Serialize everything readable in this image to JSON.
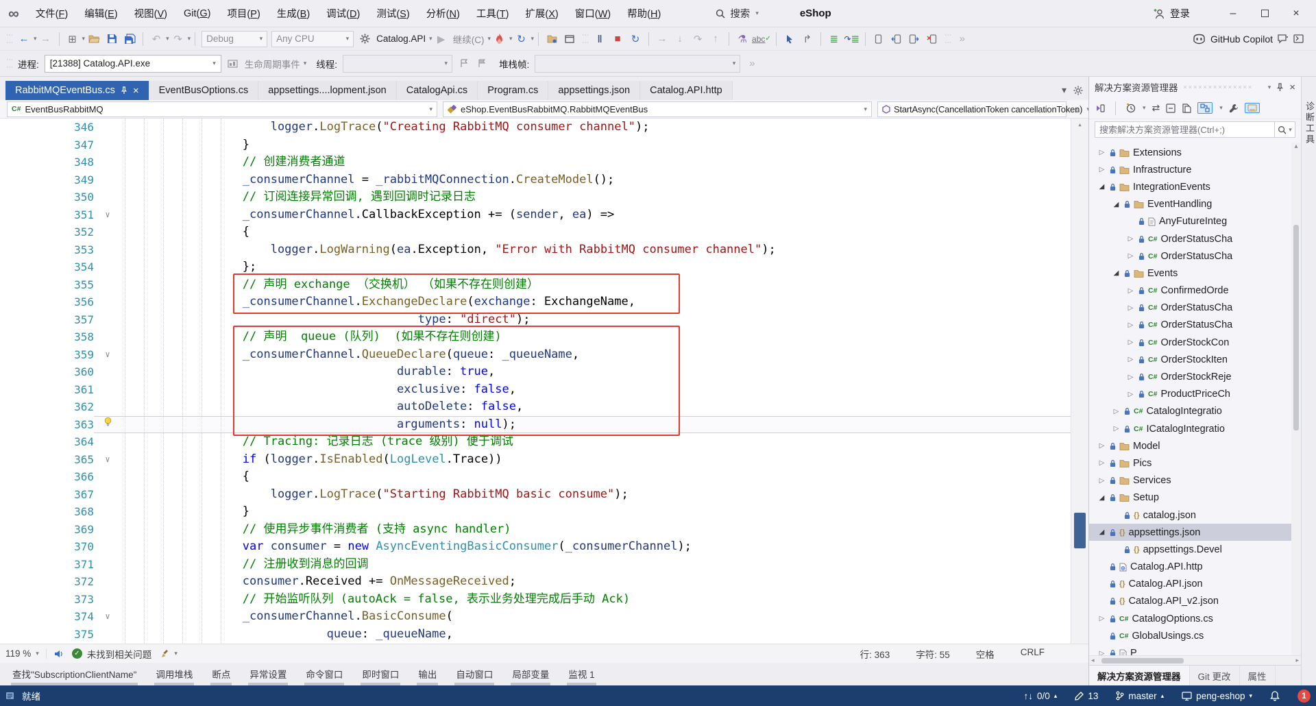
{
  "menubar": {
    "items": [
      "文件(F)",
      "编辑(E)",
      "视图(V)",
      "Git(G)",
      "项目(P)",
      "生成(B)",
      "调试(D)",
      "测试(S)",
      "分析(N)",
      "工具(T)",
      "扩展(X)",
      "窗口(W)",
      "帮助(H)"
    ],
    "search_label": "搜索",
    "project_badge": "eShop",
    "signin_label": "登录"
  },
  "toolbar": {
    "debug_config": "Debug",
    "platform": "Any CPU",
    "startup_project": "Catalog.API",
    "continue_label": "继续(C)",
    "copilot_label": "GitHub Copilot"
  },
  "debug_bar": {
    "process_label": "进程:",
    "process_value": "[21388] Catalog.API.exe",
    "lifecycle_label": "生命周期事件",
    "thread_label": "线程:",
    "stackframe_label": "堆栈帧:"
  },
  "tabs": [
    {
      "label": "RabbitMQEventBus.cs",
      "active": true
    },
    {
      "label": "EventBusOptions.cs"
    },
    {
      "label": "appsettings....lopment.json"
    },
    {
      "label": "CatalogApi.cs"
    },
    {
      "label": "Program.cs"
    },
    {
      "label": "appsettings.json"
    },
    {
      "label": "Catalog.API.http"
    }
  ],
  "breadcrumb": {
    "scope": "EventBusRabbitMQ",
    "type": "eShop.EventBusRabbitMQ.RabbitMQEventBus",
    "member": "StartAsync(CancellationToken cancellationToken)"
  },
  "editor": {
    "first_line": 346,
    "current_line": 363,
    "folds": {
      "351": "chevron",
      "359": "chevron",
      "363": "bulb",
      "365": "chevron",
      "374": "chevron"
    },
    "red_boxes": [
      {
        "from": 355,
        "to": 356
      },
      {
        "from": 358,
        "to": 363
      }
    ],
    "lines": [
      [
        [
          "p",
          "                    "
        ],
        [
          "v",
          "logger"
        ],
        [
          "p",
          "."
        ],
        [
          "m",
          "LogTrace"
        ],
        [
          "p",
          "("
        ],
        [
          "s",
          "\"Creating RabbitMQ consumer channel\""
        ],
        [
          "p",
          ");"
        ]
      ],
      [
        [
          "p",
          "                }"
        ]
      ],
      [
        [
          "p",
          "                "
        ],
        [
          "c",
          "// 创建消费者通道"
        ]
      ],
      [
        [
          "p",
          "                "
        ],
        [
          "v",
          "_consumerChannel"
        ],
        [
          "p",
          " = "
        ],
        [
          "v",
          "_rabbitMQConnection"
        ],
        [
          "p",
          "."
        ],
        [
          "m",
          "CreateModel"
        ],
        [
          "p",
          "();"
        ]
      ],
      [
        [
          "p",
          "                "
        ],
        [
          "c",
          "// 订阅连接异常回调, 遇到回调时记录日志"
        ]
      ],
      [
        [
          "p",
          "                "
        ],
        [
          "v",
          "_consumerChannel"
        ],
        [
          "p",
          ".CallbackException += ("
        ],
        [
          "v",
          "sender"
        ],
        [
          "p",
          ", "
        ],
        [
          "v",
          "ea"
        ],
        [
          "p",
          ") =>"
        ]
      ],
      [
        [
          "p",
          "                {"
        ]
      ],
      [
        [
          "p",
          "                    "
        ],
        [
          "v",
          "logger"
        ],
        [
          "p",
          "."
        ],
        [
          "m",
          "LogWarning"
        ],
        [
          "p",
          "("
        ],
        [
          "v",
          "ea"
        ],
        [
          "p",
          ".Exception, "
        ],
        [
          "s",
          "\"Error with RabbitMQ consumer channel\""
        ],
        [
          "p",
          ");"
        ]
      ],
      [
        [
          "p",
          "                };"
        ]
      ],
      [
        [
          "p",
          "                "
        ],
        [
          "c",
          "// 声明 exchange （交换机） （如果不存在则创建）"
        ]
      ],
      [
        [
          "p",
          "                "
        ],
        [
          "v",
          "_consumerChannel"
        ],
        [
          "p",
          "."
        ],
        [
          "m",
          "ExchangeDeclare"
        ],
        [
          "p",
          "("
        ],
        [
          "v",
          "exchange"
        ],
        [
          "p",
          ": ExchangeName,"
        ]
      ],
      [
        [
          "p",
          "                                         "
        ],
        [
          "v",
          "type"
        ],
        [
          "p",
          ": "
        ],
        [
          "s",
          "\"direct\""
        ],
        [
          "p",
          ");"
        ]
      ],
      [
        [
          "p",
          "                "
        ],
        [
          "c",
          "// 声明  queue (队列)  (如果不存在则创建)"
        ]
      ],
      [
        [
          "p",
          "                "
        ],
        [
          "v",
          "_consumerChannel"
        ],
        [
          "p",
          "."
        ],
        [
          "m",
          "QueueDeclare"
        ],
        [
          "p",
          "("
        ],
        [
          "v",
          "queue"
        ],
        [
          "p",
          ": "
        ],
        [
          "v",
          "_queueName"
        ],
        [
          "p",
          ","
        ]
      ],
      [
        [
          "p",
          "                                      "
        ],
        [
          "v",
          "durable"
        ],
        [
          "p",
          ": "
        ],
        [
          "k",
          "true"
        ],
        [
          "p",
          ","
        ]
      ],
      [
        [
          "p",
          "                                      "
        ],
        [
          "v",
          "exclusive"
        ],
        [
          "p",
          ": "
        ],
        [
          "k",
          "false"
        ],
        [
          "p",
          ","
        ]
      ],
      [
        [
          "p",
          "                                      "
        ],
        [
          "v",
          "autoDelete"
        ],
        [
          "p",
          ": "
        ],
        [
          "k",
          "false"
        ],
        [
          "p",
          ","
        ]
      ],
      [
        [
          "p",
          "                                      "
        ],
        [
          "v",
          "arguments"
        ],
        [
          "p",
          ": "
        ],
        [
          "k",
          "null"
        ],
        [
          "p",
          ");"
        ]
      ],
      [
        [
          "p",
          "                "
        ],
        [
          "c",
          "// Tracing: 记录日志 (trace 级别) 便于调试"
        ]
      ],
      [
        [
          "p",
          "                "
        ],
        [
          "k",
          "if"
        ],
        [
          "p",
          " ("
        ],
        [
          "v",
          "logger"
        ],
        [
          "p",
          "."
        ],
        [
          "m",
          "IsEnabled"
        ],
        [
          "p",
          "("
        ],
        [
          "t",
          "LogLevel"
        ],
        [
          "p",
          ".Trace))"
        ]
      ],
      [
        [
          "p",
          "                {"
        ]
      ],
      [
        [
          "p",
          "                    "
        ],
        [
          "v",
          "logger"
        ],
        [
          "p",
          "."
        ],
        [
          "m",
          "LogTrace"
        ],
        [
          "p",
          "("
        ],
        [
          "s",
          "\"Starting RabbitMQ basic consume\""
        ],
        [
          "p",
          ");"
        ]
      ],
      [
        [
          "p",
          "                }"
        ]
      ],
      [
        [
          "p",
          "                "
        ],
        [
          "c",
          "// 使用异步事件消费者 (支持 async handler)"
        ]
      ],
      [
        [
          "p",
          "                "
        ],
        [
          "k",
          "var"
        ],
        [
          "p",
          " "
        ],
        [
          "v",
          "consumer"
        ],
        [
          "p",
          " = "
        ],
        [
          "k",
          "new"
        ],
        [
          "p",
          " "
        ],
        [
          "t",
          "AsyncEventingBasicConsumer"
        ],
        [
          "p",
          "("
        ],
        [
          "v",
          "_consumerChannel"
        ],
        [
          "p",
          ");"
        ]
      ],
      [
        [
          "p",
          "                "
        ],
        [
          "c",
          "// 注册收到消息的回调"
        ]
      ],
      [
        [
          "p",
          "                "
        ],
        [
          "v",
          "consumer"
        ],
        [
          "p",
          ".Received += "
        ],
        [
          "m",
          "OnMessageReceived"
        ],
        [
          "p",
          ";"
        ]
      ],
      [
        [
          "p",
          "                "
        ],
        [
          "c",
          "// 开始监听队列 (autoAck = false, 表示业务处理完成后手动 Ack)"
        ]
      ],
      [
        [
          "p",
          "                "
        ],
        [
          "v",
          "_consumerChannel"
        ],
        [
          "p",
          "."
        ],
        [
          "m",
          "BasicConsume"
        ],
        [
          "p",
          "("
        ]
      ],
      [
        [
          "p",
          "                            "
        ],
        [
          "v",
          "queue"
        ],
        [
          "p",
          ": "
        ],
        [
          "v",
          "_queueName"
        ],
        [
          "p",
          ","
        ]
      ]
    ]
  },
  "editor_status": {
    "zoom_level": "119 %",
    "health_text": "未找到相关问题",
    "line": "行: 363",
    "column": "字符: 55",
    "spaces": "空格",
    "eol": "CRLF"
  },
  "bottom_tabs": [
    "查找\"SubscriptionClientName\"",
    "调用堆栈",
    "断点",
    "异常设置",
    "命令窗口",
    "即时窗口",
    "输出",
    "自动窗口",
    "局部变量",
    "监视 1"
  ],
  "solution_explorer": {
    "title": "解决方案资源管理器",
    "search_placeholder": "搜索解决方案资源管理器(Ctrl+;)",
    "panel_tabs": [
      {
        "label": "解决方案资源管理器",
        "active": true
      },
      {
        "label": "Git 更改"
      },
      {
        "label": "属性"
      }
    ],
    "tree": [
      {
        "level": 0,
        "arrow": "c",
        "icon": "folder",
        "label": "Extensions"
      },
      {
        "level": 0,
        "arrow": "c",
        "icon": "folder",
        "label": "Infrastructure"
      },
      {
        "level": 0,
        "arrow": "e",
        "icon": "folder",
        "label": "IntegrationEvents"
      },
      {
        "level": 1,
        "arrow": "e",
        "icon": "folder",
        "label": "EventHandling"
      },
      {
        "level": 2,
        "arrow": "",
        "icon": "file",
        "label": "AnyFutureInteg"
      },
      {
        "level": 2,
        "arrow": "c",
        "icon": "cs",
        "label": "OrderStatusCha"
      },
      {
        "level": 2,
        "arrow": "c",
        "icon": "cs",
        "label": "OrderStatusCha"
      },
      {
        "level": 1,
        "arrow": "e",
        "icon": "folder",
        "label": "Events"
      },
      {
        "level": 2,
        "arrow": "c",
        "icon": "cs",
        "label": "ConfirmedOrde"
      },
      {
        "level": 2,
        "arrow": "c",
        "icon": "cs",
        "label": "OrderStatusCha"
      },
      {
        "level": 2,
        "arrow": "c",
        "icon": "cs",
        "label": "OrderStatusCha"
      },
      {
        "level": 2,
        "arrow": "c",
        "icon": "cs",
        "label": "OrderStockCon"
      },
      {
        "level": 2,
        "arrow": "c",
        "icon": "cs",
        "label": "OrderStockIten"
      },
      {
        "level": 2,
        "arrow": "c",
        "icon": "cs",
        "label": "OrderStockReje"
      },
      {
        "level": 2,
        "arrow": "c",
        "icon": "cs",
        "label": "ProductPriceCh"
      },
      {
        "level": 1,
        "arrow": "c",
        "icon": "cs",
        "label": "CatalogIntegratio"
      },
      {
        "level": 1,
        "arrow": "c",
        "icon": "cs",
        "label": "ICatalogIntegratio"
      },
      {
        "level": 0,
        "arrow": "c",
        "icon": "folder",
        "label": "Model"
      },
      {
        "level": 0,
        "arrow": "c",
        "icon": "folder",
        "label": "Pics"
      },
      {
        "level": 0,
        "arrow": "c",
        "icon": "folder",
        "label": "Services"
      },
      {
        "level": 0,
        "arrow": "e",
        "icon": "folder",
        "label": "Setup"
      },
      {
        "level": 1,
        "arrow": "",
        "icon": "json",
        "label": "catalog.json"
      },
      {
        "level": 0,
        "arrow": "e",
        "icon": "json",
        "label": "appsettings.json",
        "selected": true
      },
      {
        "level": 1,
        "arrow": "",
        "icon": "json",
        "label": "appsettings.Devel"
      },
      {
        "level": 0,
        "arrow": "",
        "icon": "http",
        "label": "Catalog.API.http"
      },
      {
        "level": 0,
        "arrow": "",
        "icon": "json",
        "label": "Catalog.API.json"
      },
      {
        "level": 0,
        "arrow": "",
        "icon": "json",
        "label": "Catalog.API_v2.json"
      },
      {
        "level": 0,
        "arrow": "c",
        "icon": "cs",
        "label": "CatalogOptions.cs"
      },
      {
        "level": 0,
        "arrow": "",
        "icon": "cs",
        "label": "GlobalUsings.cs"
      },
      {
        "level": 0,
        "arrow": "c",
        "icon": "file",
        "label": "P"
      }
    ]
  },
  "right_strip": {
    "tab_label": "诊断工具"
  },
  "statusbar": {
    "ready": "就绪",
    "sync_count": "0/0",
    "edit_count": "13",
    "branch": "master",
    "repo": "peng-eshop",
    "notification_count": "1"
  },
  "icons": {
    "dropdown": "▾",
    "back": "←",
    "forward": "→",
    "undo": "↶",
    "redo": "↷",
    "play": "▶",
    "stop": "■",
    "restart": "↻",
    "pause": "Ⅱ",
    "sync": "⇄",
    "step_into": "↓",
    "step_out": "↑",
    "step_over": "↷",
    "overflow": "»",
    "check": "✓",
    "close": "×",
    "split": "↕",
    "up_small": "▴",
    "down_small": "▾",
    "left_small": "◂",
    "right_small": "▸"
  },
  "colors": {
    "active_tab": "#3063B1",
    "statusbar": "#1B3E6E",
    "selection": "#CCCEDB",
    "annotation": "#DD3B32",
    "comment": "#008000",
    "string": "#A31515",
    "keyword": "#0000FF",
    "type": "#2B91AF",
    "method": "#795E26",
    "identifier": "#1F377F"
  }
}
